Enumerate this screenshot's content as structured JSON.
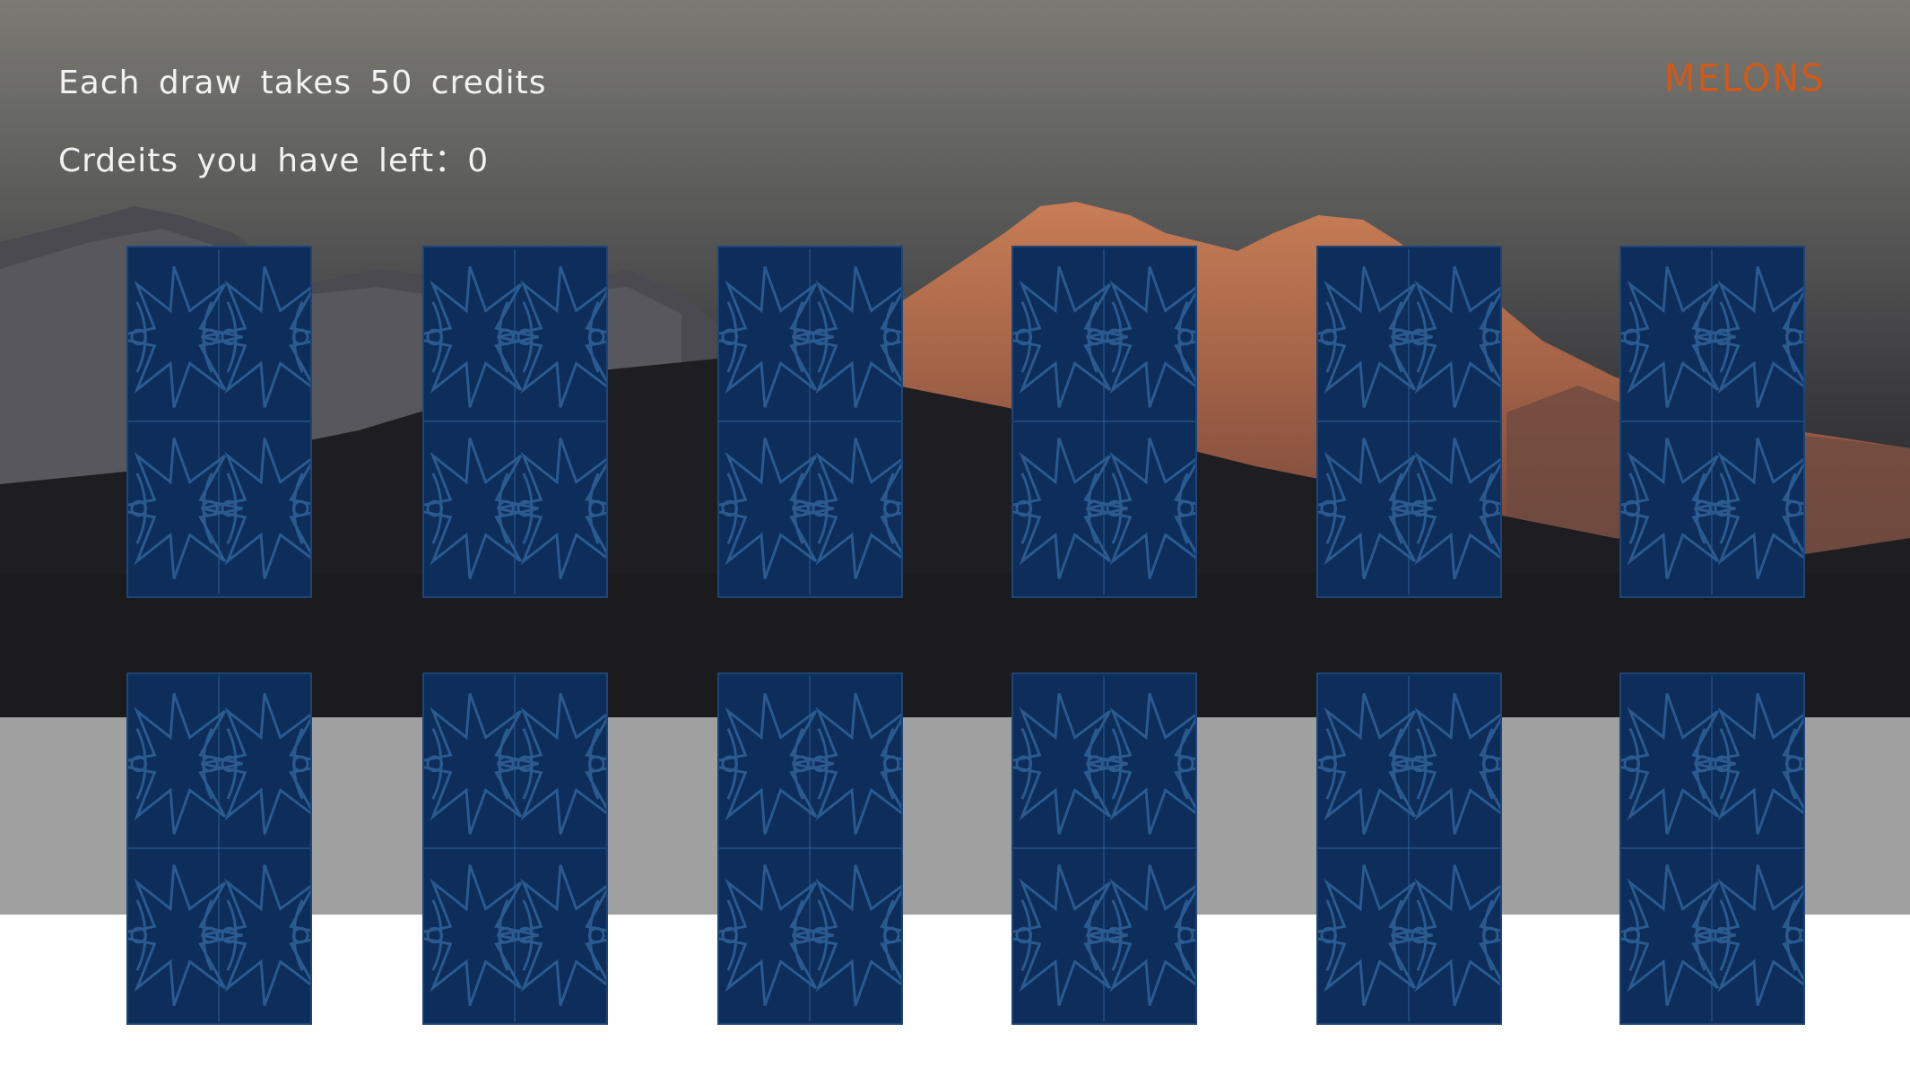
{
  "game": {
    "cost_text": "Each draw takes 50 credits",
    "credits_label": "Crdeits you have left：",
    "credits_value": "0",
    "brand": "MELONS"
  },
  "cards": [
    {
      "row": 1,
      "col": 1
    },
    {
      "row": 1,
      "col": 2
    },
    {
      "row": 1,
      "col": 3
    },
    {
      "row": 1,
      "col": 4
    },
    {
      "row": 1,
      "col": 5
    },
    {
      "row": 1,
      "col": 6
    },
    {
      "row": 2,
      "col": 1
    },
    {
      "row": 2,
      "col": 2
    },
    {
      "row": 2,
      "col": 3
    },
    {
      "row": 2,
      "col": 4
    },
    {
      "row": 2,
      "col": 5
    },
    {
      "row": 2,
      "col": 6
    }
  ],
  "colors": {
    "card_back": "#0d2d5b",
    "card_pattern": "#2b5a8f",
    "brand": "#cf5a1a"
  }
}
